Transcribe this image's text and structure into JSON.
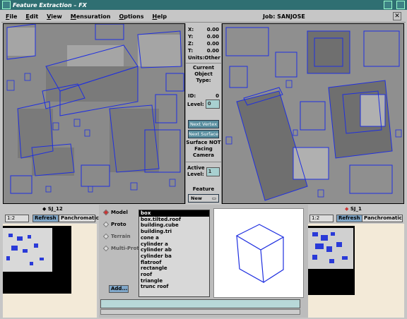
{
  "window": {
    "title": "Feature Extraction – FX"
  },
  "menu": [
    "File",
    "Edit",
    "View",
    "Mensuration",
    "Options",
    "Help"
  ],
  "job": "Job: SANJOSE",
  "coords": [
    {
      "label": "X:",
      "value": "0.00"
    },
    {
      "label": "Y:",
      "value": "0.00"
    },
    {
      "label": "Z:",
      "value": "0.00"
    },
    {
      "label": "T:",
      "value": "0.00"
    }
  ],
  "units": {
    "label": "Units:",
    "value": "Other"
  },
  "current_object": {
    "title": "Current Object",
    "type_label": "Type:",
    "id_label": "ID:",
    "id_value": "0",
    "level_label": "Level:",
    "level_value": "0"
  },
  "buttons": {
    "next_vertex": "Next Vertex",
    "next_surface": "Next Surface"
  },
  "status": "Surface NOT Facing Camera",
  "active_level": {
    "label1": "Active",
    "label2": "Level:",
    "value": "1"
  },
  "feature": {
    "label": "Feature",
    "new_label": "New"
  },
  "left_view": {
    "name": "SJ_12",
    "zoom": "1:2",
    "refresh": "Refresh",
    "band": "Panchromatic"
  },
  "right_view": {
    "name": "SJ_1",
    "zoom": "1:2",
    "refresh": "Refresh",
    "band": "Panchromatic"
  },
  "model_options": [
    {
      "label": "Model",
      "selected": true
    },
    {
      "label": "Proto",
      "selected": false
    },
    {
      "label": "Terrain",
      "selected": false
    },
    {
      "label": "Multi-Proto",
      "selected": false
    }
  ],
  "add_button": "Add...",
  "model_list": [
    "box",
    "box.tilted.roof",
    "building.cube",
    "building.tri",
    "cone a",
    "cylinder a",
    "cylinder ab",
    "cylinder ba",
    "flatroof",
    "rectangle",
    "roof",
    "triangle",
    "trunc roof"
  ],
  "colors": {
    "wireframe": "#1f2fe0",
    "title_bar": "#2f6f72"
  }
}
